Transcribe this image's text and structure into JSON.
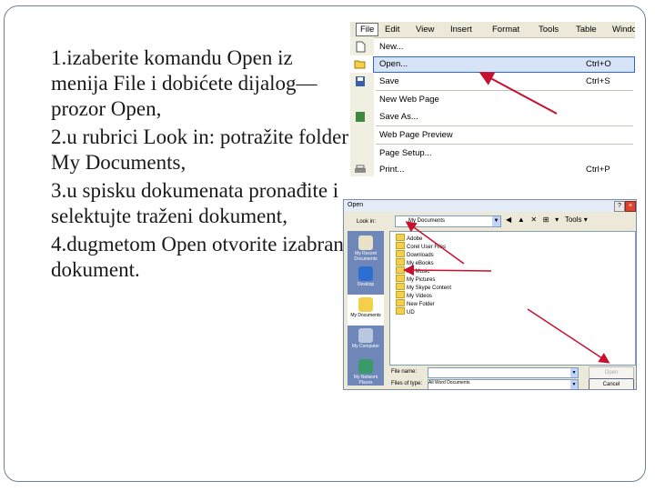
{
  "slide": {
    "bullets": [
      {
        "marker": "",
        "text": "1.izaberite komandu Open iz menija File i dobićete dijalog—prozor Open,"
      },
      {
        "marker": "",
        "text": "2.u rubrici Look in: potražite folder My Documents,"
      },
      {
        "marker": "",
        "text": "3.u spisku dokumenata pronađite i selektujte traženi dokument,"
      },
      {
        "marker": "",
        "text": "4.dugmetom Open otvorite izabrani dokument."
      }
    ]
  },
  "file_menu": {
    "menubar": [
      "File",
      "Edit",
      "View",
      "Insert",
      "Format",
      "Tools",
      "Table",
      "Windo"
    ],
    "items": [
      {
        "label": "New...",
        "shortcut": ""
      },
      {
        "label": "Open...",
        "shortcut": "Ctrl+O"
      },
      {
        "label": "Save",
        "shortcut": "Ctrl+S"
      },
      {
        "label": "New Web Page",
        "shortcut": ""
      },
      {
        "label": "Save As...",
        "shortcut": ""
      },
      {
        "label": "Web Page Preview",
        "shortcut": ""
      },
      {
        "label": "Page Setup...",
        "shortcut": ""
      },
      {
        "label": "Print...",
        "shortcut": "Ctrl+P"
      }
    ]
  },
  "open_dialog": {
    "title": "Open",
    "help": "?",
    "close": "×",
    "look_in_label": "Look in:",
    "look_in_value": "My Documents",
    "toolbar": [
      "◀",
      "▲",
      "✕",
      "⊞",
      "▾",
      "Tools ▾"
    ],
    "places": [
      "My Recent Documents",
      "Desktop",
      "My Documents",
      "My Computer",
      "My Network Places"
    ],
    "files": [
      "Adobe",
      "Corel User Files",
      "Downloads",
      "My eBooks",
      "My Music",
      "My Pictures",
      "My Skype Content",
      "My Videos",
      "New Folder",
      "UD"
    ],
    "file_name_label": "File name:",
    "file_name_value": "",
    "file_type_label": "Files of type:",
    "file_type_value": "All Word Documents",
    "open_button": "Open",
    "cancel_button": "Cancel"
  },
  "colors": {
    "arrow": "#c8102e",
    "bullet": "#6d7f9a",
    "menu_highlight": "#316ac5"
  }
}
